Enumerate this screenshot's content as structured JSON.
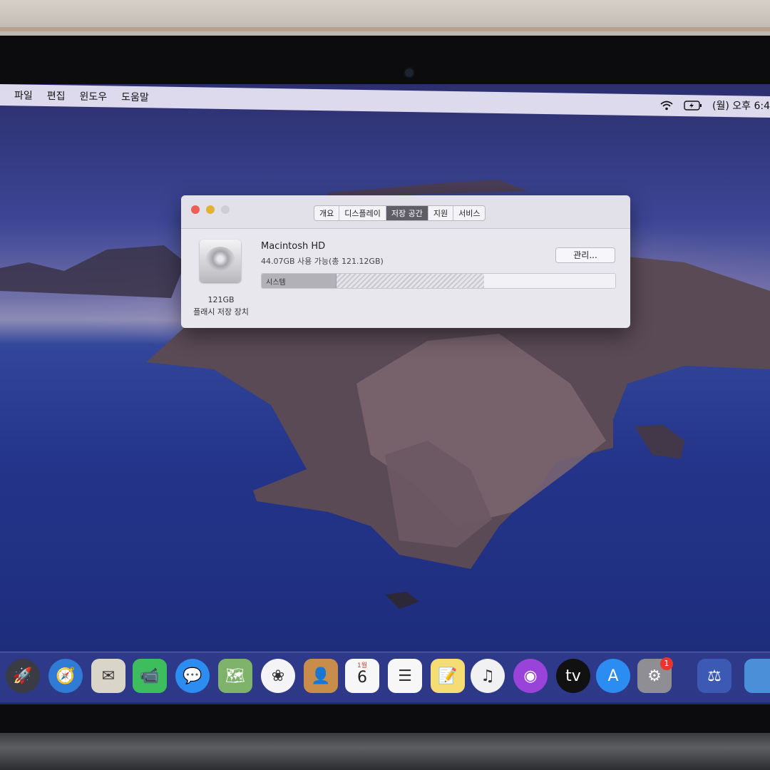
{
  "menubar": {
    "items": [
      "파일",
      "편집",
      "윈도우",
      "도움말"
    ],
    "status": {
      "wifi_icon": "wifi-icon",
      "battery_icon": "battery-charging-icon",
      "datetime": "(월) 오후 6:4"
    }
  },
  "window": {
    "tabs": [
      {
        "label": "개요",
        "active": false
      },
      {
        "label": "디스플레이",
        "active": false
      },
      {
        "label": "저장 공간",
        "active": true
      },
      {
        "label": "지원",
        "active": false
      },
      {
        "label": "서비스",
        "active": false
      }
    ],
    "disk": {
      "icon": "hard-drive-icon",
      "capacity": "121GB",
      "type": "플래시 저장 장치",
      "volume_name": "Macintosh HD",
      "available_text": "44.07GB 사용 가능(총 121.12GB)",
      "manage_button": "관리...",
      "usage": {
        "system_label": "시스템",
        "system_fraction": 0.21,
        "other_fraction": 0.42,
        "free_fraction": 0.37
      }
    }
  },
  "dock": {
    "apps": [
      {
        "name": "launchpad-icon",
        "glyph": "🚀"
      },
      {
        "name": "safari-icon",
        "glyph": "🧭"
      },
      {
        "name": "mail-icon",
        "glyph": "✉"
      },
      {
        "name": "facetime-icon",
        "glyph": "📹"
      },
      {
        "name": "messages-icon",
        "glyph": "💬"
      },
      {
        "name": "maps-icon",
        "glyph": "🗺"
      },
      {
        "name": "photos-icon",
        "glyph": "❀"
      },
      {
        "name": "contacts-icon",
        "glyph": "👤"
      },
      {
        "name": "calendar-icon",
        "glyph": "6"
      },
      {
        "name": "reminders-icon",
        "glyph": "☰"
      },
      {
        "name": "notes-icon",
        "glyph": "📝"
      },
      {
        "name": "music-icon",
        "glyph": "♫"
      },
      {
        "name": "podcasts-icon",
        "glyph": "◉"
      },
      {
        "name": "apple-tv-icon",
        "glyph": "tv"
      },
      {
        "name": "app-store-icon",
        "glyph": "A"
      },
      {
        "name": "system-preferences-icon",
        "glyph": "⚙"
      },
      {
        "name": "system-information-icon",
        "glyph": "⚖"
      },
      {
        "name": "folder-icon",
        "glyph": ""
      }
    ],
    "calendar_month": "1월",
    "calendar_day": "6",
    "settings_badge": "1"
  }
}
